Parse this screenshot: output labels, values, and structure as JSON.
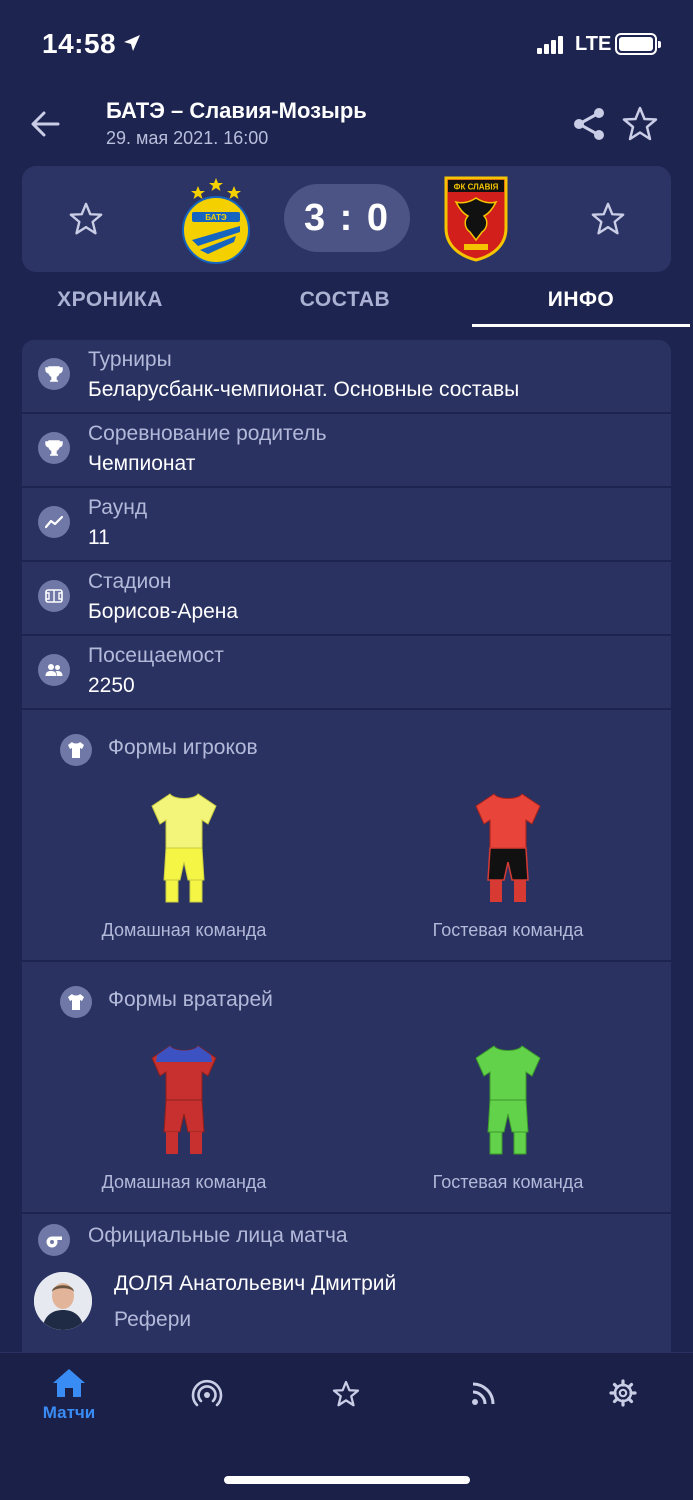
{
  "status_bar": {
    "time": "14:58",
    "network": "LTE"
  },
  "header": {
    "title": "БАТЭ – Славия-Мозырь",
    "date": "29. мая 2021. 16:00",
    "share_icon": "share-icon",
    "favorite_icon": "star-icon"
  },
  "score": {
    "home_team": "БАТЭ",
    "away_team": "Славия-Мозырь",
    "text": "3 : 0",
    "home_logo_text": "БАТЭ",
    "away_logo_text": "ФК СЛАВІЯ"
  },
  "tabs": [
    {
      "label": "ХРОНИКА",
      "active": false
    },
    {
      "label": "СОСТАВ",
      "active": false
    },
    {
      "label": "ИНФО",
      "active": true
    }
  ],
  "info_rows": [
    {
      "label": "Турниры",
      "value": "Беларусбанк-чемпионат. Основные составы",
      "icon": "trophy-icon"
    },
    {
      "label": "Соревнование родитель",
      "value": "Чемпионат",
      "icon": "trophy-icon"
    },
    {
      "label": "Раунд",
      "value": "11",
      "icon": "trend-icon"
    },
    {
      "label": "Стадион",
      "value": "Борисов-Арена",
      "icon": "stadium-icon"
    },
    {
      "label": "Посещаемост",
      "value": "2250",
      "icon": "people-icon"
    }
  ],
  "player_kits": {
    "title": "Формы игроков",
    "home_caption": "Домашная команда",
    "away_caption": "Гостевая команда",
    "home_colors": {
      "shirt": "#f2f57a",
      "shorts": "#f5f545",
      "socks": "#f5f545"
    },
    "away_colors": {
      "shirt": "#e8443a",
      "shorts": "#111111",
      "socks": "#d63a32"
    }
  },
  "goalkeeper_kits": {
    "title": "Формы вратарей",
    "home_caption": "Домашная команда",
    "away_caption": "Гостевая команда",
    "home_colors": {
      "shirt": "#c7302e",
      "band": "#3d52c2",
      "shorts": "#c7302e",
      "socks": "#c7302e"
    },
    "away_colors": {
      "shirt": "#62d24a",
      "shorts": "#62d24a",
      "socks": "#62d24a"
    }
  },
  "officials": {
    "title": "Официальные лица матча",
    "referee_name": "ДОЛЯ Анатольевич Дмитрий",
    "referee_role": "Рефери"
  },
  "tabbar": {
    "items": [
      {
        "label": "Матчи",
        "icon": "home-icon",
        "active": true
      },
      {
        "label": "",
        "icon": "live-icon",
        "active": false
      },
      {
        "label": "",
        "icon": "star-icon",
        "active": false
      },
      {
        "label": "",
        "icon": "rss-icon",
        "active": false
      },
      {
        "label": "",
        "icon": "gear-icon",
        "active": false
      }
    ]
  },
  "colors": {
    "background": "#1d2450",
    "card": "#2a3262",
    "accent": "#3a8cf5"
  }
}
